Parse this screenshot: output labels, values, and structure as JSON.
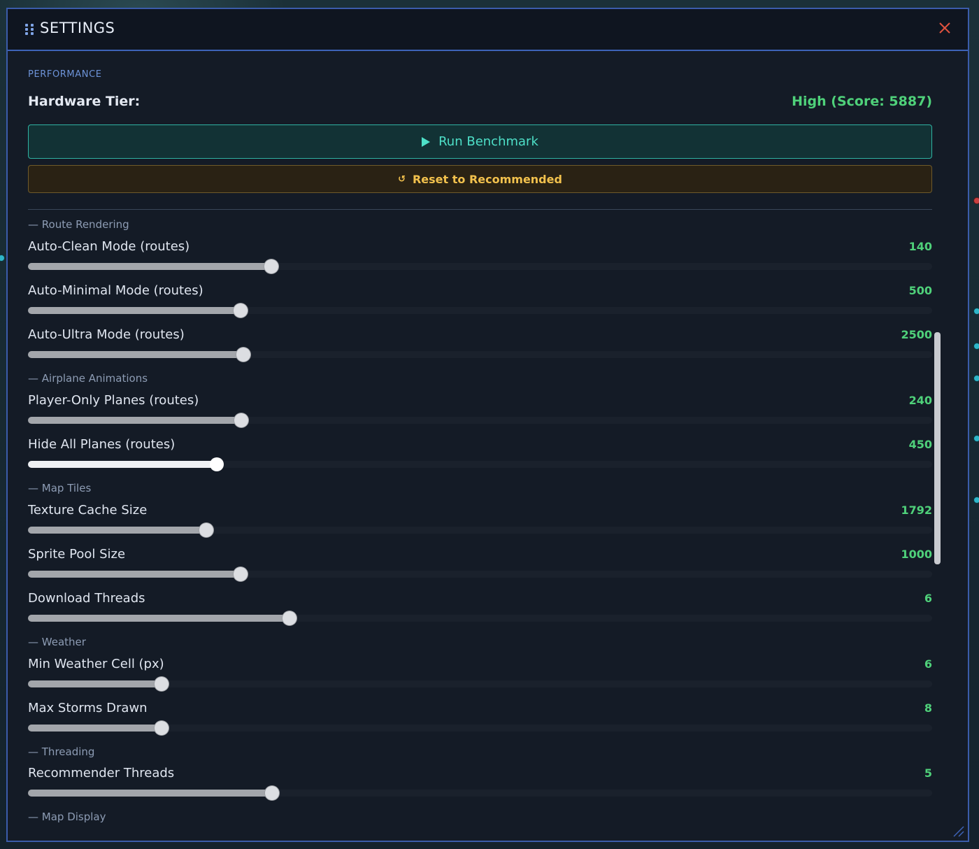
{
  "window": {
    "title": "SETTINGS"
  },
  "performance": {
    "section_label": "PERFORMANCE",
    "hardware_label": "Hardware Tier:",
    "hardware_value": "High (Score: 5887)",
    "run_benchmark_label": "Run Benchmark",
    "reset_label": "Reset to Recommended"
  },
  "groups": [
    {
      "label": "— Route Rendering"
    },
    {
      "label": "— Airplane Animations"
    },
    {
      "label": "— Map Tiles"
    },
    {
      "label": "— Weather"
    },
    {
      "label": "— Threading"
    },
    {
      "label": "— Map Display"
    }
  ],
  "sliders": [
    {
      "label": "Auto-Clean Mode (routes)",
      "value": "140",
      "fill_fraction": 0.269
    },
    {
      "label": "Auto-Minimal Mode (routes)",
      "value": "500",
      "fill_fraction": 0.235
    },
    {
      "label": "Auto-Ultra Mode (routes)",
      "value": "2500",
      "fill_fraction": 0.238
    },
    {
      "label": "Player-Only Planes (routes)",
      "value": "240",
      "fill_fraction": 0.236
    },
    {
      "label": "Hide All Planes (routes)",
      "value": "450",
      "fill_fraction": 0.209
    },
    {
      "label": "Texture Cache Size",
      "value": "1792",
      "fill_fraction": 0.197
    },
    {
      "label": "Sprite Pool Size",
      "value": "1000",
      "fill_fraction": 0.235
    },
    {
      "label": "Download Threads",
      "value": "6",
      "fill_fraction": 0.289
    },
    {
      "label": "Min Weather Cell (px)",
      "value": "6",
      "fill_fraction": 0.148
    },
    {
      "label": "Max Storms Drawn",
      "value": "8",
      "fill_fraction": 0.148
    },
    {
      "label": "Recommender Threads",
      "value": "5",
      "fill_fraction": 0.27
    }
  ],
  "colors": {
    "accent_blue": "#3d63b8",
    "value_green": "#4fd17a",
    "benchmark_teal": "#4ee0c8",
    "reset_gold": "#f2c14d",
    "close_red": "#e0523f"
  }
}
